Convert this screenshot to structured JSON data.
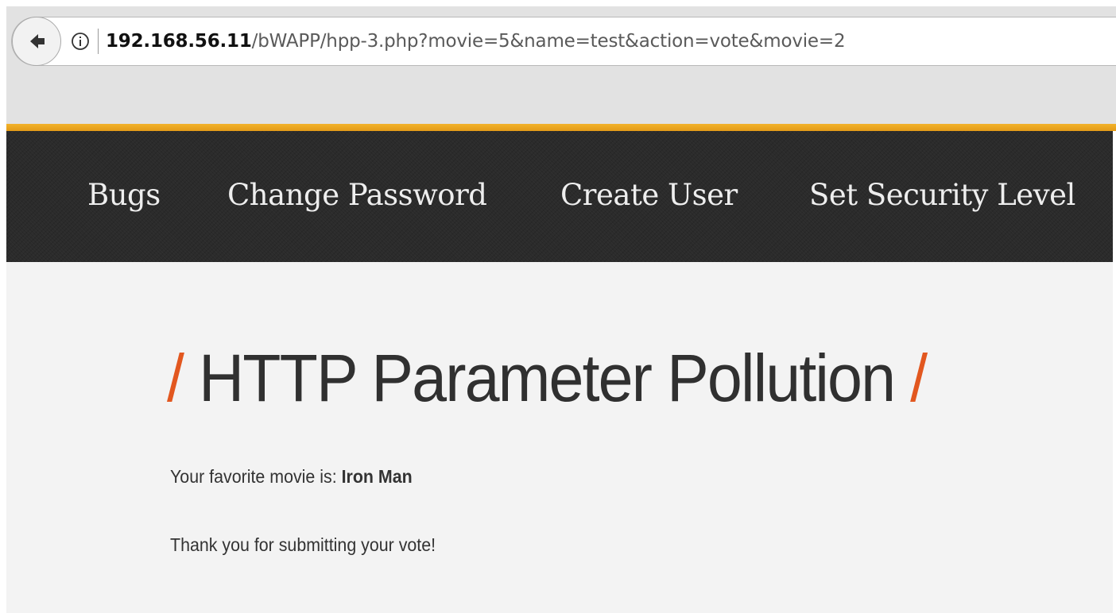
{
  "browser": {
    "back_icon": "arrow-left-icon",
    "info_icon": "info-circle-icon",
    "url": {
      "host": "192.168.56.11",
      "path": "/bWAPP/hpp-3.php?movie=5&name=test&action=vote&movie=2"
    },
    "accent_color": "#f0a81f"
  },
  "nav": {
    "items": [
      {
        "label": "Bugs"
      },
      {
        "label": "Change Password"
      },
      {
        "label": "Create User"
      },
      {
        "label": "Set Security Level"
      }
    ]
  },
  "main": {
    "title": {
      "slash_left": "/",
      "text": "HTTP Parameter Pollution",
      "slash_right": "/",
      "slash_color": "#e2571f"
    },
    "favorite": {
      "label": "Your favorite movie is:",
      "value": "Iron Man"
    },
    "thanks": "Thank you for submitting your vote!"
  }
}
